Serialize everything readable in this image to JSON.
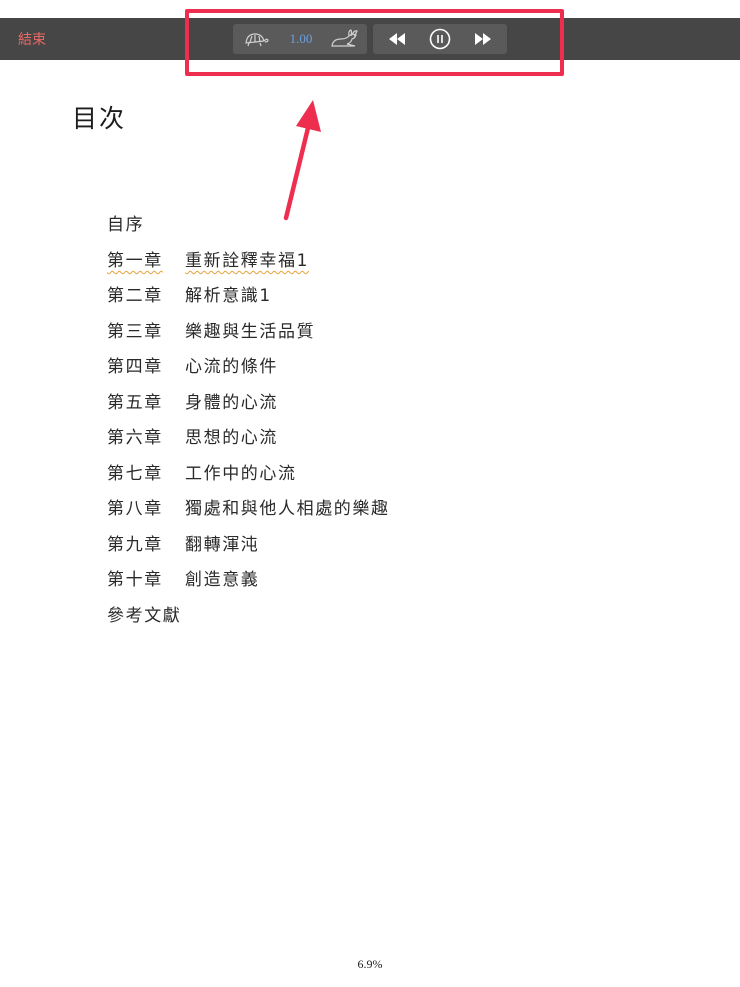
{
  "toolbar": {
    "end_label": "結束",
    "speed_value": "1.00",
    "icons": {
      "slow": "turtle-icon",
      "fast": "rabbit-icon",
      "rewind": "rewind-icon",
      "pause": "pause-icon",
      "forward": "fast-forward-icon"
    },
    "colors": {
      "bar": "#464646",
      "group": "#5a5a5a",
      "end": "#e86a66",
      "speed": "#6aa0e0"
    }
  },
  "annotation": {
    "color": "#ee2e4e"
  },
  "toc": {
    "title": "目次",
    "items": [
      {
        "chapter": "自序",
        "name": ""
      },
      {
        "chapter": "第一章",
        "name": "重新詮釋幸福1"
      },
      {
        "chapter": "第二章",
        "name": "解析意識1"
      },
      {
        "chapter": "第三章",
        "name": "樂趣與生活品質"
      },
      {
        "chapter": "第四章",
        "name": "心流的條件"
      },
      {
        "chapter": "第五章",
        "name": "身體的心流"
      },
      {
        "chapter": "第六章",
        "name": "思想的心流"
      },
      {
        "chapter": "第七章",
        "name": "工作中的心流"
      },
      {
        "chapter": "第八章",
        "name": "獨處和與他人相處的樂趣"
      },
      {
        "chapter": "第九章",
        "name": "翻轉渾沌"
      },
      {
        "chapter": "第十章",
        "name": "創造意義"
      },
      {
        "chapter": "參考文獻",
        "name": ""
      }
    ]
  },
  "progress": "6.9%"
}
